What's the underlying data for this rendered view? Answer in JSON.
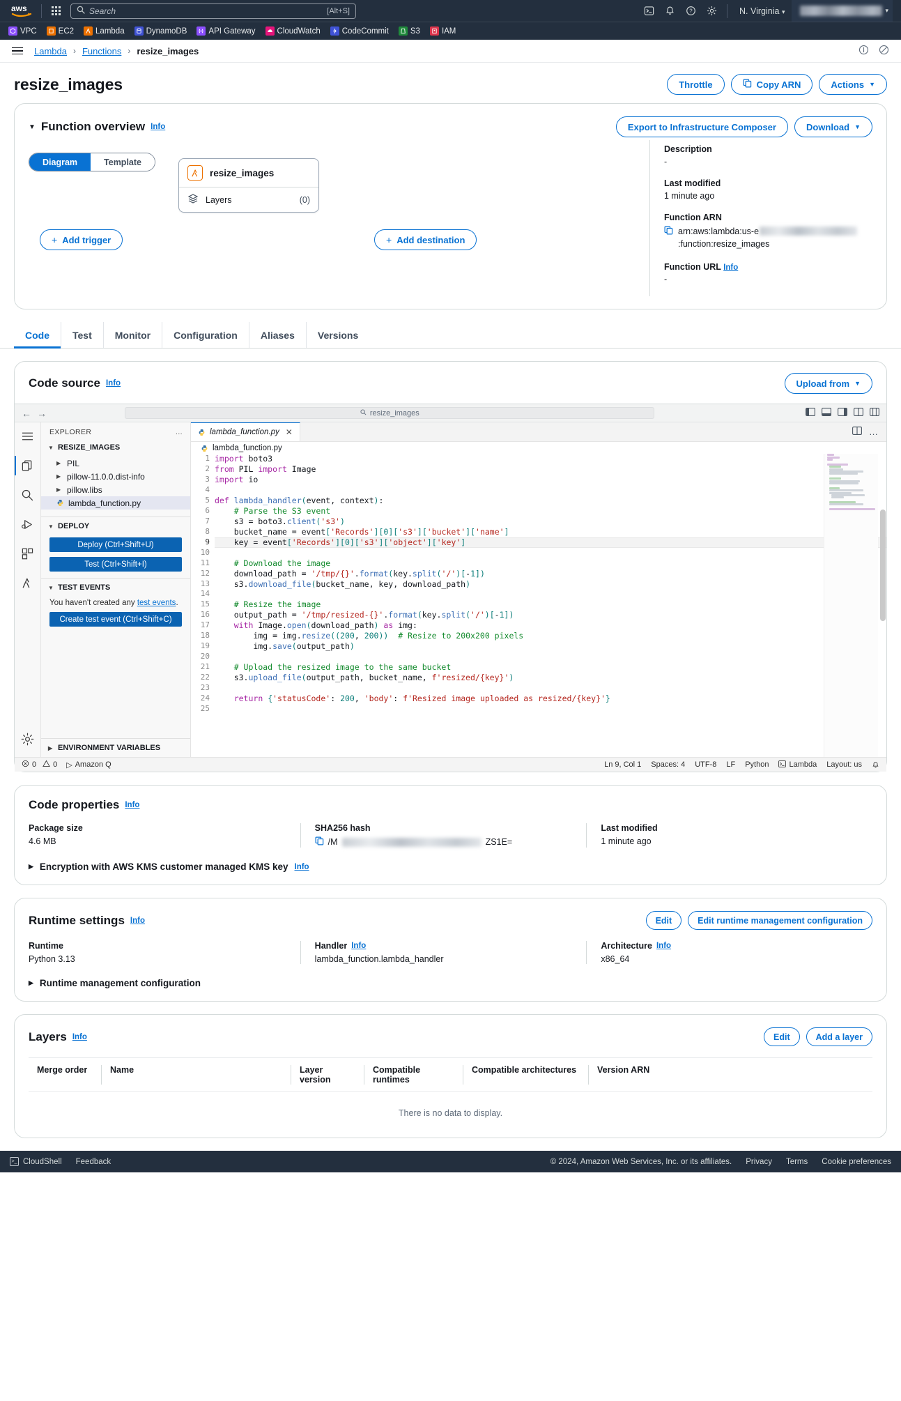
{
  "topnav": {
    "search_placeholder": "Search",
    "search_value": "",
    "shortcut": "[Alt+S]",
    "region": "N. Virginia",
    "icons": [
      "cloudshell-icon",
      "bell-icon",
      "help-icon",
      "settings-icon"
    ]
  },
  "services": [
    {
      "label": "VPC",
      "color": "#8c4fff"
    },
    {
      "label": "EC2",
      "color": "#ed7100"
    },
    {
      "label": "Lambda",
      "color": "#ed7100"
    },
    {
      "label": "DynamoDB",
      "color": "#4053d6"
    },
    {
      "label": "API Gateway",
      "color": "#8c4fff"
    },
    {
      "label": "CloudWatch",
      "color": "#e7157b"
    },
    {
      "label": "CodeCommit",
      "color": "#4053d6"
    },
    {
      "label": "S3",
      "color": "#1f8a3b"
    },
    {
      "label": "IAM",
      "color": "#dd344c"
    }
  ],
  "breadcrumb": {
    "items": [
      "Lambda",
      "Functions",
      "resize_images"
    ]
  },
  "page": {
    "title": "resize_images",
    "actions": [
      "Throttle",
      "Copy ARN",
      "Actions"
    ]
  },
  "overview": {
    "heading": "Function overview",
    "info": "Info",
    "export_button": "Export to Infrastructure Composer",
    "download_button": "Download",
    "view_toggle": [
      "Diagram",
      "Template"
    ],
    "active_view": "Diagram",
    "node_name": "resize_images",
    "layers_label": "Layers",
    "layers_count": "(0)",
    "add_trigger": "Add trigger",
    "add_destination": "Add destination",
    "details": {
      "description_label": "Description",
      "description_value": "-",
      "last_modified_label": "Last modified",
      "last_modified_value": "1 minute ago",
      "arn_label": "Function ARN",
      "arn_prefix": "arn:aws:lambda:us-e",
      "arn_suffix": ":function:resize_images",
      "url_label": "Function URL",
      "url_info": "Info",
      "url_value": "-"
    }
  },
  "tabs": {
    "items": [
      "Code",
      "Test",
      "Monitor",
      "Configuration",
      "Aliases",
      "Versions"
    ],
    "active": "Code"
  },
  "code_source": {
    "heading": "Code source",
    "info": "Info",
    "upload_button": "Upload from",
    "toolbar_search": "resize_images",
    "explorer": {
      "title": "EXPLORER",
      "root": "RESIZE_IMAGES",
      "items": [
        {
          "label": "PIL",
          "type": "folder"
        },
        {
          "label": "pillow-11.0.0.dist-info",
          "type": "folder"
        },
        {
          "label": "pillow.libs",
          "type": "folder"
        },
        {
          "label": "lambda_function.py",
          "type": "python",
          "selected": true
        }
      ],
      "deploy_section": "DEPLOY",
      "deploy_button": "Deploy (Ctrl+Shift+U)",
      "test_button": "Test (Ctrl+Shift+I)",
      "test_events_section": "TEST EVENTS",
      "test_events_text": "You haven't created any ",
      "test_events_link": "test events",
      "test_events_text_end": ".",
      "create_test_event_button": "Create test event (Ctrl+Shift+C)",
      "env_vars_section": "ENVIRONMENT VARIABLES"
    },
    "editor": {
      "tab_name": "lambda_function.py",
      "breadcrumb_file": "lambda_function.py",
      "cursor_line": 9,
      "lines": [
        "import boto3",
        "from PIL import Image",
        "import io",
        "",
        "def lambda_handler(event, context):",
        "    # Parse the S3 event",
        "    s3 = boto3.client('s3')",
        "    bucket_name = event['Records'][0]['s3']['bucket']['name']",
        "    key = event['Records'][0]['s3']['object']['key']",
        "",
        "    # Download the image",
        "    download_path = '/tmp/{}'.format(key.split('/')[-1])",
        "    s3.download_file(bucket_name, key, download_path)",
        "",
        "    # Resize the image",
        "    output_path = '/tmp/resized-{}'.format(key.split('/')[-1])",
        "    with Image.open(download_path) as img:",
        "        img = img.resize((200, 200))  # Resize to 200x200 pixels",
        "        img.save(output_path)",
        "",
        "    # Upload the resized image to the same bucket",
        "    s3.upload_file(output_path, bucket_name, f'resized/{key}')",
        "",
        "    return {'statusCode': 200, 'body': f'Resized image uploaded as resized/{key}'}",
        ""
      ]
    },
    "statusbar": {
      "errors": "0",
      "warnings": "0",
      "amazon_q": "Amazon Q",
      "position": "Ln 9, Col 1",
      "spaces": "Spaces: 4",
      "encoding": "UTF-8",
      "eol": "LF",
      "language": "Python",
      "lambda": "Lambda",
      "layout": "Layout: us"
    }
  },
  "code_properties": {
    "heading": "Code properties",
    "info": "Info",
    "package_size_label": "Package size",
    "package_size_value": "4.6 MB",
    "sha_label": "SHA256 hash",
    "sha_prefix": "/M",
    "sha_suffix": "ZS1E=",
    "last_modified_label": "Last modified",
    "last_modified_value": "1 minute ago",
    "encryption_expander": "Encryption with AWS KMS customer managed KMS key",
    "encryption_info": "Info"
  },
  "runtime_settings": {
    "heading": "Runtime settings",
    "info": "Info",
    "edit_button": "Edit",
    "edit_runtime_button": "Edit runtime management configuration",
    "runtime_label": "Runtime",
    "runtime_value": "Python 3.13",
    "handler_label": "Handler",
    "handler_info": "Info",
    "handler_value": "lambda_function.lambda_handler",
    "architecture_label": "Architecture",
    "architecture_info": "Info",
    "architecture_value": "x86_64",
    "runtime_mgmt_expander": "Runtime management configuration"
  },
  "layers": {
    "heading": "Layers",
    "info": "Info",
    "edit_button": "Edit",
    "add_button": "Add a layer",
    "columns": [
      "Merge order",
      "Name",
      "Layer version",
      "Compatible runtimes",
      "Compatible architectures",
      "Version ARN"
    ],
    "empty_text": "There is no data to display."
  },
  "footer": {
    "cloudshell": "CloudShell",
    "feedback": "Feedback",
    "copyright": "© 2024, Amazon Web Services, Inc. or its affiliates.",
    "links": [
      "Privacy",
      "Terms",
      "Cookie preferences"
    ]
  },
  "colors": {
    "aws_navy": "#232f3e",
    "link_blue": "#0972d3",
    "lambda_orange": "#ed7100"
  }
}
